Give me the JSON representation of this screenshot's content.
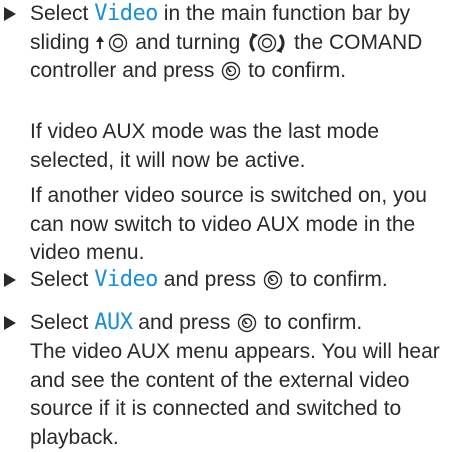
{
  "steps": [
    {
      "kw": "Video",
      "pre": "Select ",
      "p1": " in the main function bar by sliding ",
      "p2": " and turning ",
      "p3": " the COMAND controller and press ",
      "p4": " to confirm.",
      "icons": [
        "slide-controller-icon",
        "turn-controller-icon",
        "press-controller-icon"
      ]
    },
    {
      "kw": "Video",
      "pre": "Select ",
      "post": " and press ",
      "end": " to confirm."
    },
    {
      "kw": "AUX",
      "pre": "Select ",
      "post": " and press ",
      "end": " to confirm."
    }
  ],
  "paragraphs": {
    "last_mode_note": "If video AUX mode was the last mode selected, it will now be active.",
    "other_source_note": "If another video source is switched on, you can now switch to video AUX mode in the video menu.",
    "result_note": "The video AUX menu appears. You will hear and see the content of the external video source if it is connected and switched to playback."
  },
  "colors": {
    "text": "#2a2a2a",
    "keyword": "#1a8fd6"
  }
}
